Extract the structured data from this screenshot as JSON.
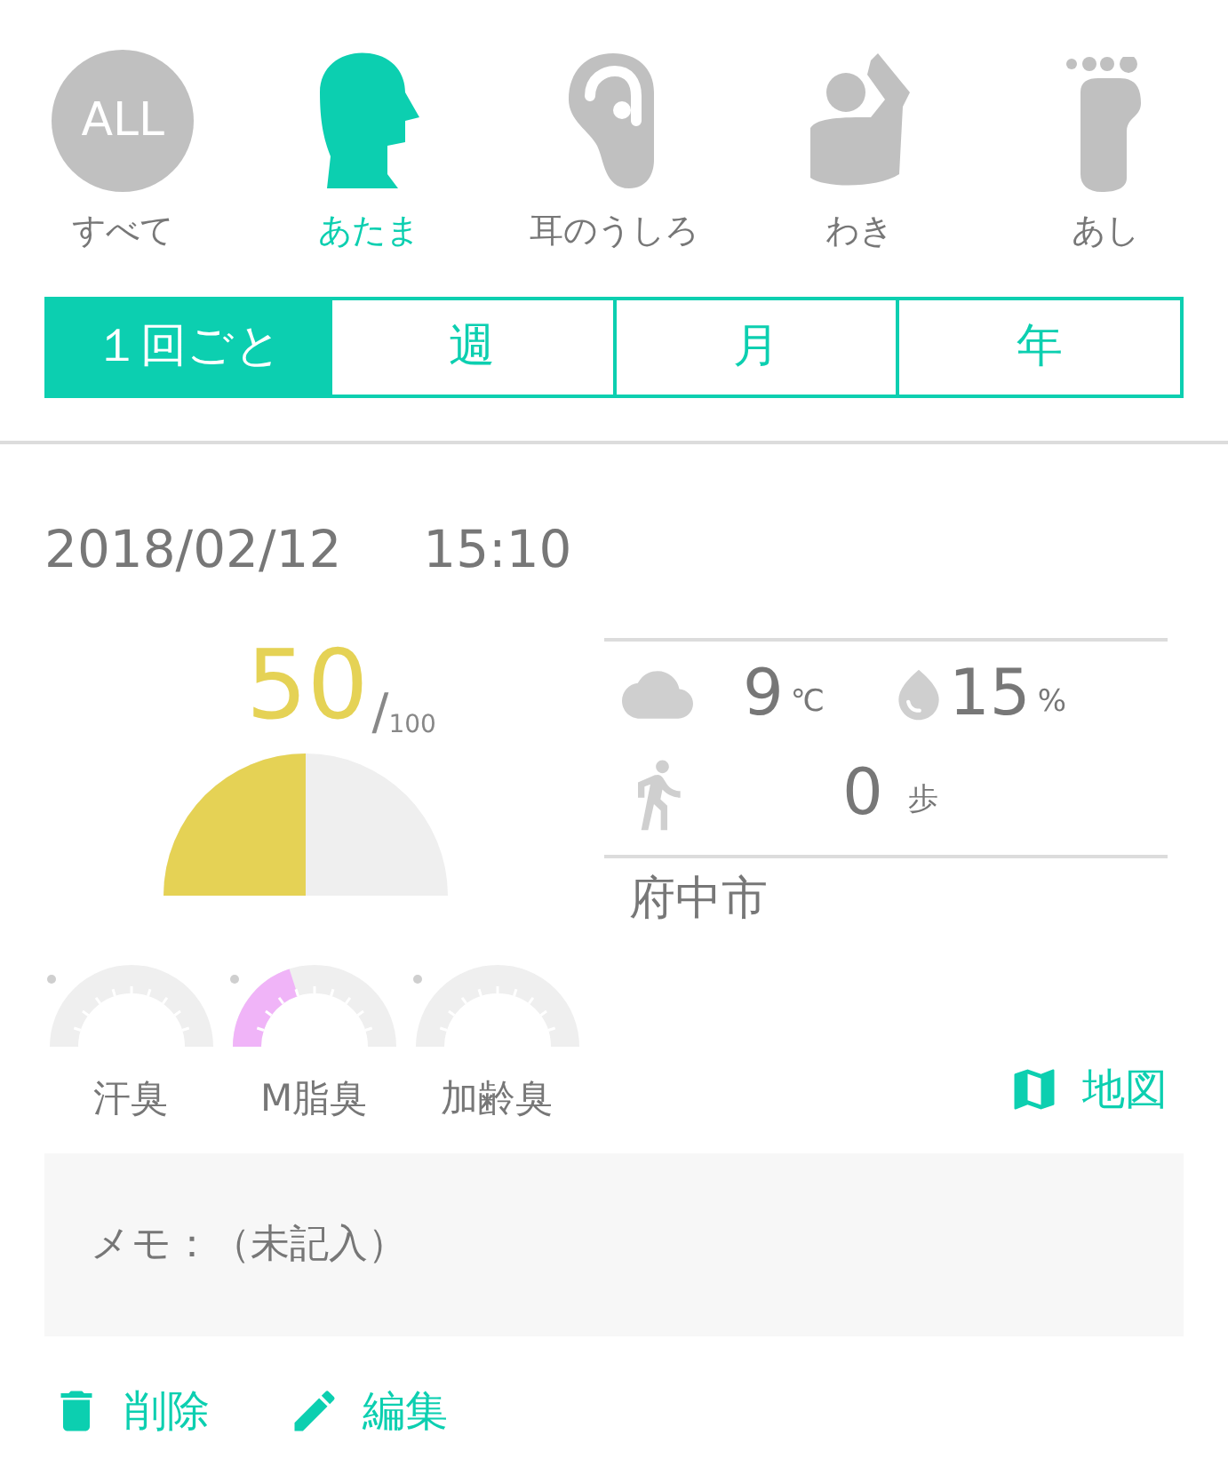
{
  "body_parts": [
    {
      "kind": "all",
      "badge": "ALL",
      "label": "すべて",
      "selected": false
    },
    {
      "kind": "head",
      "label": "あたま",
      "selected": true
    },
    {
      "kind": "ear",
      "label": "耳のうしろ",
      "selected": false
    },
    {
      "kind": "armpit",
      "label": "わき",
      "selected": false
    },
    {
      "kind": "foot",
      "label": "あし",
      "selected": false
    }
  ],
  "period_tabs": [
    {
      "label": "１回ごと",
      "selected": true
    },
    {
      "label": "週",
      "selected": false
    },
    {
      "label": "月",
      "selected": false
    },
    {
      "label": "年",
      "selected": false
    }
  ],
  "record": {
    "date": "2018/02/12",
    "time": "15:10",
    "score": {
      "value": "50",
      "slash": "/",
      "max": "100"
    },
    "odors": [
      {
        "label": "汗臭"
      },
      {
        "label": "M脂臭"
      },
      {
        "label": "加齢臭"
      }
    ],
    "weather": {
      "temperature": "9",
      "temperature_unit": "℃",
      "humidity": "15",
      "humidity_unit": "%"
    },
    "steps": {
      "value": "0",
      "unit": "歩"
    },
    "city": "府中市",
    "map_link": "地図",
    "memo": "メモ：（未記入）",
    "actions": [
      {
        "kind": "delete",
        "label": "削除"
      },
      {
        "kind": "edit",
        "label": "編集"
      }
    ]
  }
}
